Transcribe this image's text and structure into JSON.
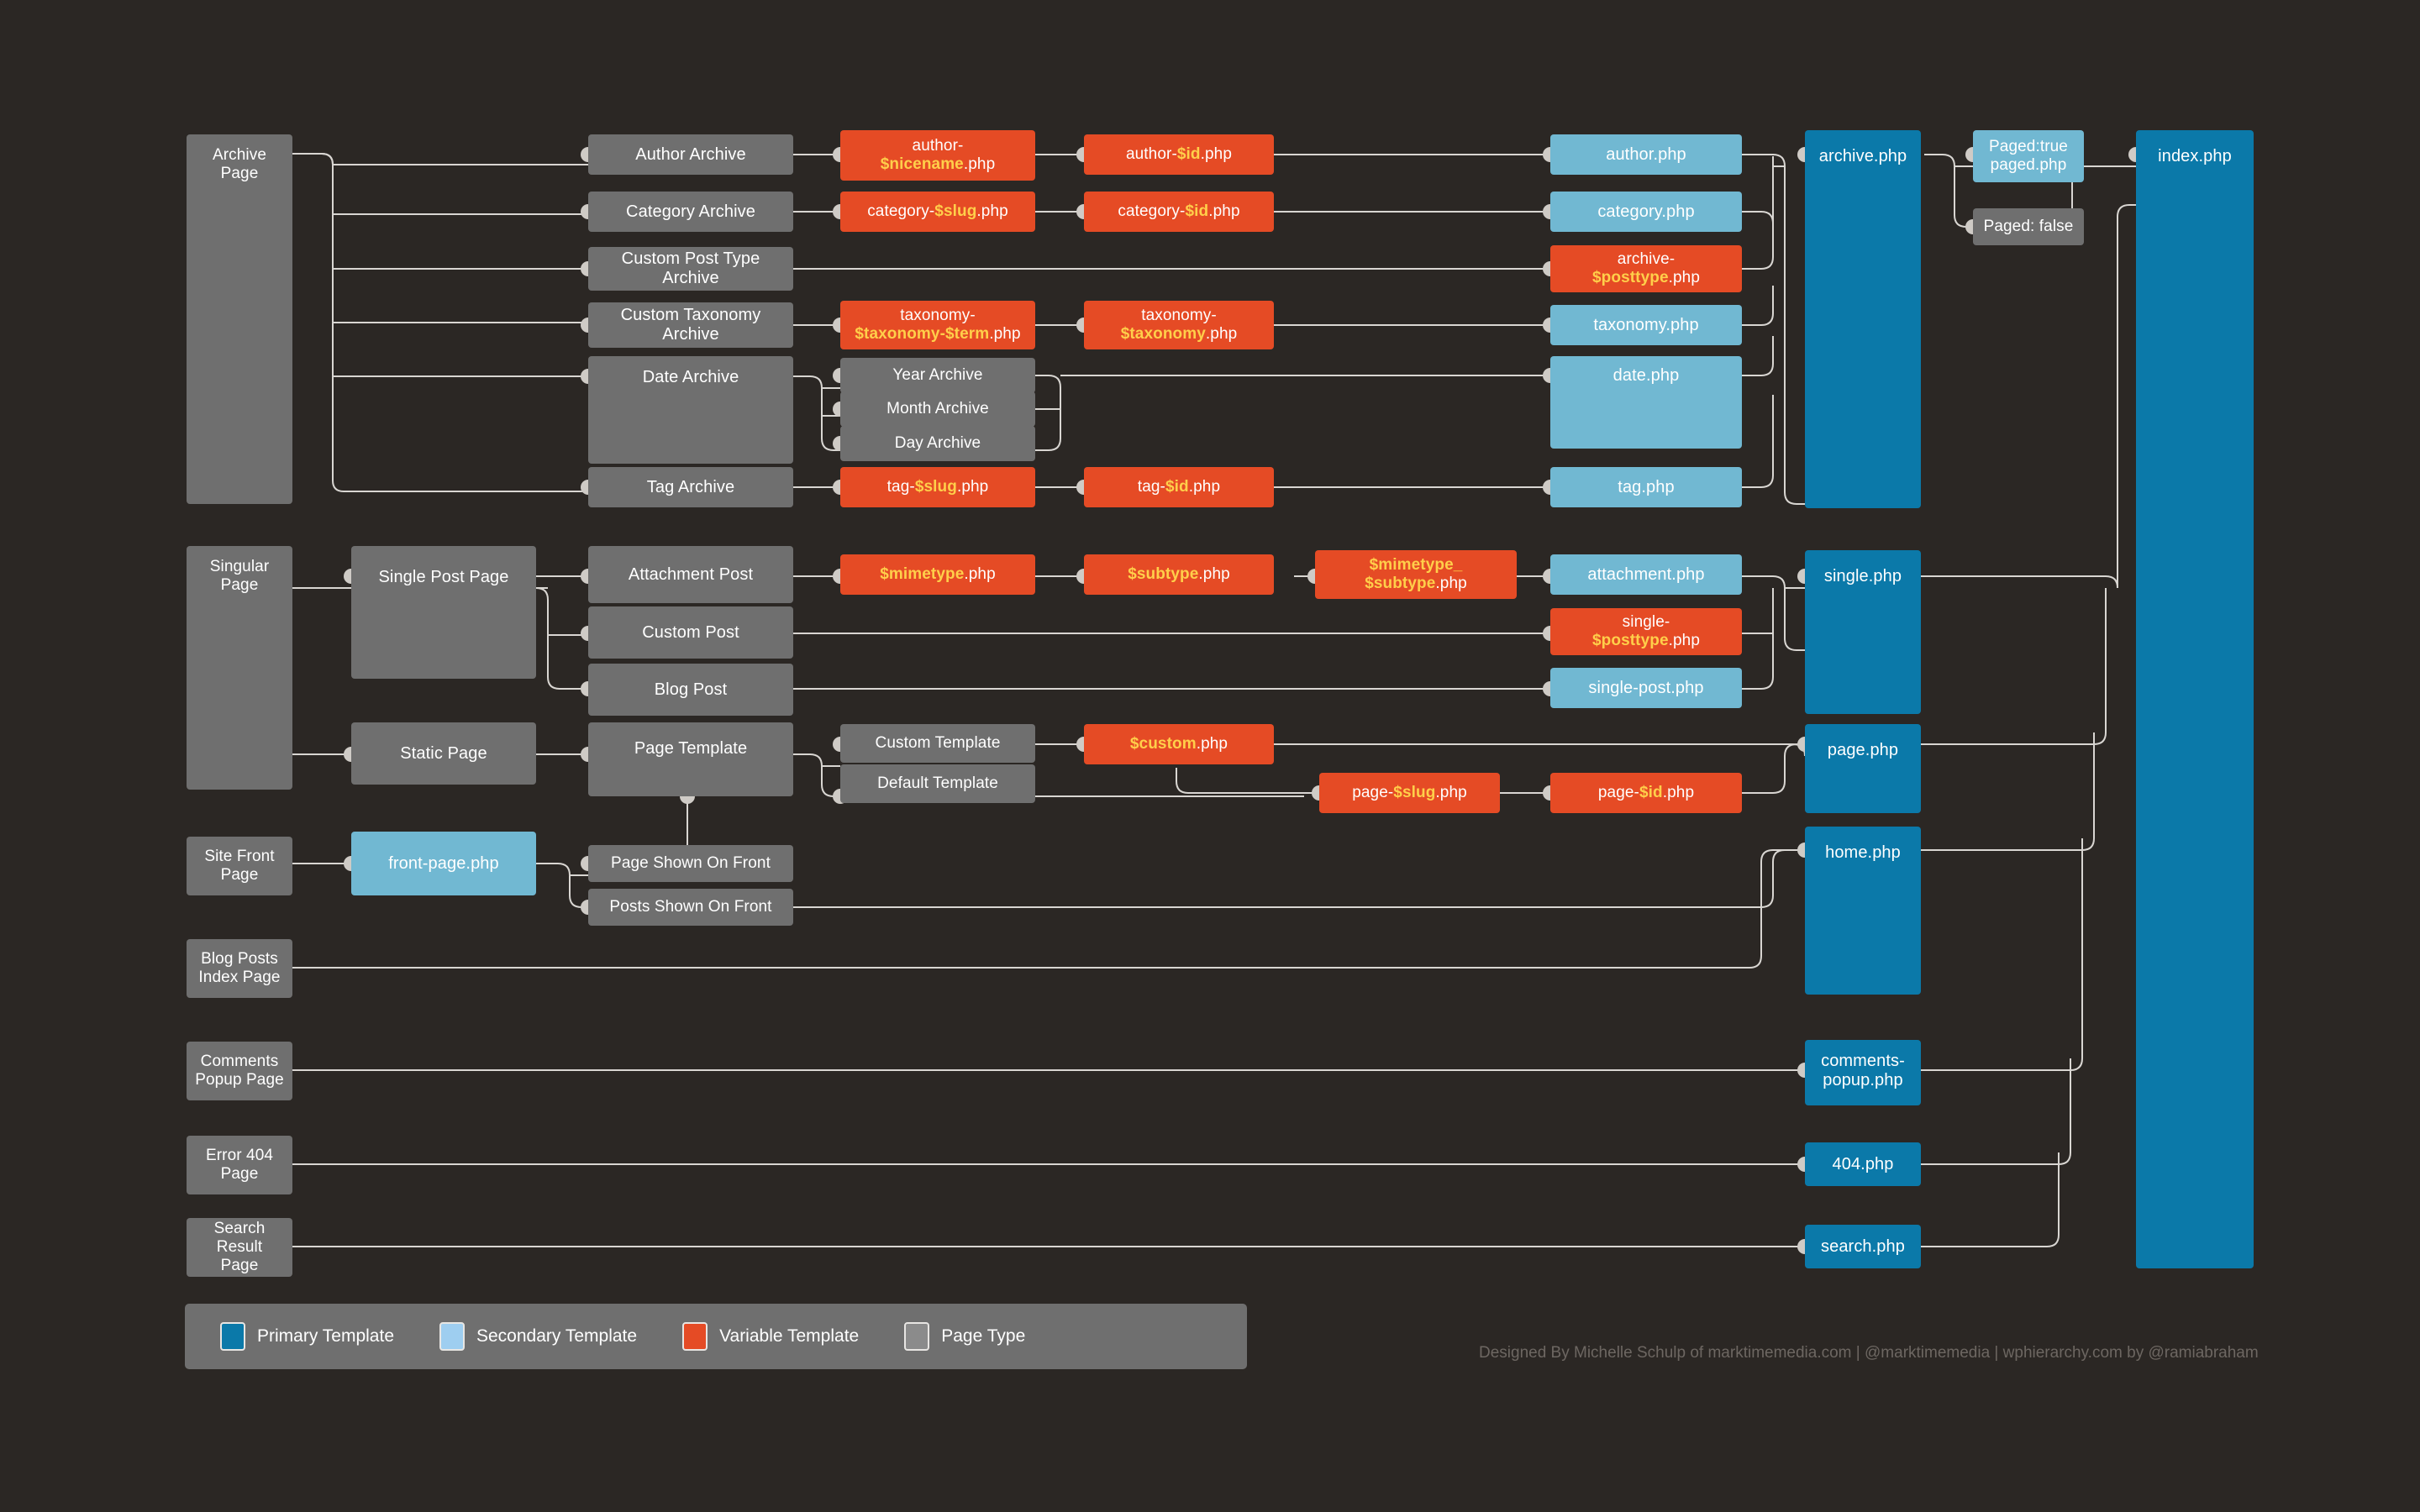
{
  "meta": {
    "title": "WordPress Template Hierarchy",
    "background_color": "#2b2724",
    "credits": "Designed By Michelle Schulp of marktimemedia.com  |  @marktimemedia  |  wphierarchy.com by @ramiabraham"
  },
  "colors": {
    "primary_template": "#0b79a9",
    "secondary_template": "#71b8d2",
    "variable_template": "#e54b25",
    "page_type": "#6f6f6f",
    "variable_text": "#ffcf4a",
    "connector": "#d9d6d2"
  },
  "legend": {
    "items": [
      {
        "label": "Primary Template",
        "color": "#0b79a9",
        "kind": "primary"
      },
      {
        "label": "Secondary Template",
        "color": "#71b8d2",
        "kind": "secondary"
      },
      {
        "label": "Variable Template",
        "color": "#e54b25",
        "kind": "variable"
      },
      {
        "label": "Page Type",
        "color": "#6f6f6f",
        "kind": "pagetype"
      }
    ]
  },
  "nodes": {
    "archive_page": {
      "label": "Archive\nPage",
      "kind": "pagetype"
    },
    "singular_page": {
      "label": "Singular\nPage",
      "kind": "pagetype"
    },
    "site_front_page": {
      "label": "Site Front\nPage",
      "kind": "pagetype"
    },
    "blog_posts_index": {
      "label": "Blog Posts\nIndex Page",
      "kind": "pagetype"
    },
    "comments_popup_page": {
      "label": "Comments\nPopup Page",
      "kind": "pagetype"
    },
    "error_404_page": {
      "label": "Error 404\nPage",
      "kind": "pagetype"
    },
    "search_result_page": {
      "label": "Search Result\nPage",
      "kind": "pagetype"
    },
    "author_archive": {
      "label": "Author Archive",
      "kind": "pagetype"
    },
    "category_archive": {
      "label": "Category Archive",
      "kind": "pagetype"
    },
    "custom_post_type_archive": {
      "label": "Custom Post Type\nArchive",
      "kind": "pagetype"
    },
    "custom_taxonomy_archive": {
      "label": "Custom Taxonomy\nArchive",
      "kind": "pagetype"
    },
    "date_archive": {
      "label": "Date Archive",
      "kind": "pagetype"
    },
    "year_archive": {
      "label": "Year Archive",
      "kind": "pagetype"
    },
    "month_archive": {
      "label": "Month Archive",
      "kind": "pagetype"
    },
    "day_archive": {
      "label": "Day Archive",
      "kind": "pagetype"
    },
    "tag_archive": {
      "label": "Tag Archive",
      "kind": "pagetype"
    },
    "single_post_page": {
      "label": "Single Post Page",
      "kind": "pagetype"
    },
    "static_page": {
      "label": "Static Page",
      "kind": "pagetype"
    },
    "attachment_post": {
      "label": "Attachment Post",
      "kind": "pagetype"
    },
    "custom_post": {
      "label": "Custom Post",
      "kind": "pagetype"
    },
    "blog_post": {
      "label": "Blog Post",
      "kind": "pagetype"
    },
    "page_template": {
      "label": "Page Template",
      "kind": "pagetype"
    },
    "custom_template": {
      "label": "Custom Template",
      "kind": "pagetype"
    },
    "default_template": {
      "label": "Default Template",
      "kind": "pagetype"
    },
    "page_shown_on_front": {
      "label": "Page Shown On Front",
      "kind": "pagetype"
    },
    "posts_shown_on_front": {
      "label": "Posts Shown On Front",
      "kind": "pagetype"
    },
    "paged_false": {
      "label": "Paged: false",
      "kind": "pagetype"
    },
    "author_nicename_php": {
      "label": "author-\n$nicename.php",
      "kind": "variable",
      "var": "$nicename"
    },
    "author_id_php": {
      "label": "author-$id.php",
      "kind": "variable",
      "var": "$id"
    },
    "category_slug_php": {
      "label": "category-$slug.php",
      "kind": "variable",
      "var": "$slug"
    },
    "category_id_php": {
      "label": "category-$id.php",
      "kind": "variable",
      "var": "$id"
    },
    "archive_posttype_php": {
      "label": "archive-\n$posttype.php",
      "kind": "variable",
      "var": "$posttype"
    },
    "taxonomy_term_php": {
      "label": "taxonomy-\n$taxonomy-$term.php",
      "kind": "variable",
      "var": "$taxonomy-$term"
    },
    "taxonomy_taxonomy_php": {
      "label": "taxonomy-\n$taxonomy.php",
      "kind": "variable",
      "var": "$taxonomy"
    },
    "tag_slug_php": {
      "label": "tag-$slug.php",
      "kind": "variable",
      "var": "$slug"
    },
    "tag_id_php": {
      "label": "tag-$id.php",
      "kind": "variable",
      "var": "$id"
    },
    "mimetype_php": {
      "label": "$mimetype.php",
      "kind": "variable",
      "var": "$mimetype"
    },
    "subtype_php": {
      "label": "$subtype.php",
      "kind": "variable",
      "var": "$subtype"
    },
    "mimetype_subtype_php": {
      "label": "$mimetype_\n$subtype.php",
      "kind": "variable",
      "var": "$mimetype_$subtype"
    },
    "single_posttype_php": {
      "label": "single-\n$posttype.php",
      "kind": "variable",
      "var": "$posttype"
    },
    "custom_php": {
      "label": "$custom.php",
      "kind": "variable",
      "var": "$custom"
    },
    "page_slug_php": {
      "label": "page-$slug.php",
      "kind": "variable",
      "var": "$slug"
    },
    "page_id_php": {
      "label": "page-$id.php",
      "kind": "variable",
      "var": "$id"
    },
    "author_php": {
      "label": "author.php",
      "kind": "secondary"
    },
    "category_php": {
      "label": "category.php",
      "kind": "secondary"
    },
    "taxonomy_php": {
      "label": "taxonomy.php",
      "kind": "secondary"
    },
    "date_php": {
      "label": "date.php",
      "kind": "secondary"
    },
    "tag_php": {
      "label": "tag.php",
      "kind": "secondary"
    },
    "attachment_php": {
      "label": "attachment.php",
      "kind": "secondary"
    },
    "single_post_php": {
      "label": "single-post.php",
      "kind": "secondary"
    },
    "front_page_php": {
      "label": "front-page.php",
      "kind": "secondary"
    },
    "paged_true_php": {
      "label": "Paged:true\npaged.php",
      "kind": "secondary"
    },
    "archive_php": {
      "label": "archive.php",
      "kind": "primary"
    },
    "single_php": {
      "label": "single.php",
      "kind": "primary"
    },
    "page_php": {
      "label": "page.php",
      "kind": "primary"
    },
    "home_php": {
      "label": "home.php",
      "kind": "primary"
    },
    "comments_popup_php": {
      "label": "comments-\npopup.php",
      "kind": "primary"
    },
    "error404_php": {
      "label": "404.php",
      "kind": "primary"
    },
    "search_php": {
      "label": "search.php",
      "kind": "primary"
    },
    "index_php": {
      "label": "index.php",
      "kind": "primary"
    }
  }
}
